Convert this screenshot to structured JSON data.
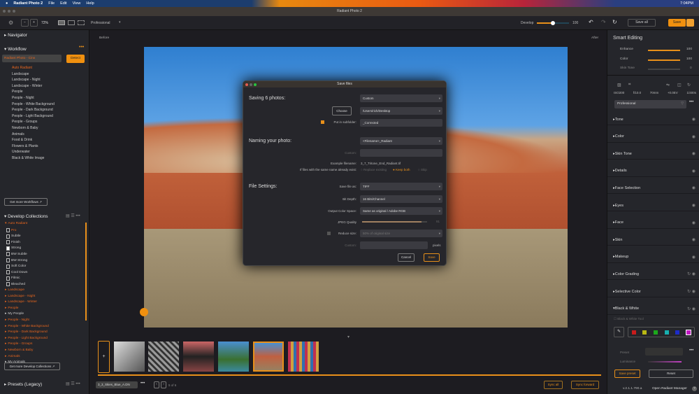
{
  "menubar": {
    "app": "Radiant Photo 2",
    "menus": [
      "File",
      "Edit",
      "View",
      "Help"
    ],
    "time": "7:04PM"
  },
  "window": {
    "title": "Radiant Photo 2"
  },
  "toolbar": {
    "zoom": "72%",
    "mode": "Professional",
    "develop_label": "Develop",
    "develop_value": "100",
    "develop_fraction": 1.0,
    "save_all": "Save all",
    "save": "Save"
  },
  "canvas": {
    "before": "Before",
    "after": "After"
  },
  "left": {
    "navigator": "Navigator",
    "workflow": "Workflow",
    "workflow_select": "Radiant Photo - Cinx",
    "detect": "Detect",
    "workflows": [
      "Auto Radiant",
      "Landscape",
      "Landscape - Night",
      "Landscape - Winter",
      "People",
      "People - Night",
      "People - White Background",
      "People - Dark Background",
      "People - Light Background",
      "People - Groups",
      "Newborn & Baby",
      "Animals",
      "Food & Drink",
      "Flowers & Plants",
      "Underwater",
      "Black & White Image"
    ],
    "get_workflows": "Get more Workflows",
    "develop_collections": "Develop Collections",
    "auto_radiant": "Auto Radiant",
    "presets": [
      "Pro",
      "Subtle",
      "Finish",
      "Strong",
      "BW Subtle",
      "BW Strong",
      "Soft Color",
      "Cool Down",
      "Filmic",
      "Bleached"
    ],
    "collections": [
      "Landscape",
      "Landscape - Night",
      "Landscape - Winter",
      "People",
      "My People",
      "People - Night",
      "People - White Background",
      "People - Dark Background",
      "People - Light Background",
      "People - Groups",
      "Newborn & Baby",
      "Animals",
      "My Animals"
    ],
    "get_collections": "Get more Develop Collections",
    "presets_legacy": "Presets (Legacy)"
  },
  "dialog": {
    "title": "Save files",
    "saving": "Saving 6 photos:",
    "preset": "Custom",
    "choose": "Choose",
    "path": "/Users/rich/Desktop",
    "subfolder_label": "Put in subfolder:",
    "subfolder": "_Corrected",
    "naming": "Naming your photo:",
    "naming_value": "<Filename>_Radiant",
    "custom_label": "Custom:",
    "example_label": "Example filename:",
    "example": "3_7_Tritone_End_Radiant.tif",
    "exists_label": "If files with the same name already exist:",
    "replace": "Replace existing",
    "keep": "Keep both",
    "skip": "Skip",
    "file_settings": "File Settings:",
    "format_label": "Save file as:",
    "format": "TIFF",
    "depth_label": "Bit Depth:",
    "depth": "16 Bits/Channel",
    "space_label": "Output Color Space:",
    "space": "Same as original / Adobe RGB",
    "quality_label": "JPEG Quality",
    "quality": "91",
    "reduce_label": "Reduce size:",
    "reduce": "50% of original size",
    "custom2_label": "Custom:",
    "pixels": "pixels",
    "cancel": "Cancel",
    "save": "Save"
  },
  "right": {
    "title": "Smart Editing",
    "enhance": "Enhance",
    "enhance_value": "100",
    "color": "Color",
    "color_value": "100",
    "skin": "Skin Tone",
    "skin_value": "0",
    "iso": "ISO200",
    "aperture": "f/10.0",
    "focal": "70mm",
    "ev": "+0.0EV",
    "shutter": "1/400s",
    "profile": "Professional",
    "sections": [
      "Tone",
      "Color",
      "Skin Tone",
      "Details",
      "Face Selection",
      "Eyes",
      "Face",
      "Skin",
      "Makeup",
      "Color Grading",
      "Selective Color",
      "Black & White"
    ],
    "bw_tool": "Black & White Tool",
    "swatches": [
      "#c81c1c",
      "#b8b814",
      "#1ca81c",
      "#18b0b0",
      "#1c2cc8",
      "#c018c0"
    ],
    "preset_label": "Preset",
    "luminance": "Luminance",
    "save_preset": "Save preset",
    "reset": "Reset",
    "version": "v.2.1.1.790.a",
    "open_manager": "Open Radiant Manager"
  },
  "bottom": {
    "file": "3_3_Skies_Blue_A.DN",
    "count": "5 of 6",
    "sync_all": "Sync all",
    "sync_forward": "Sync forward"
  }
}
